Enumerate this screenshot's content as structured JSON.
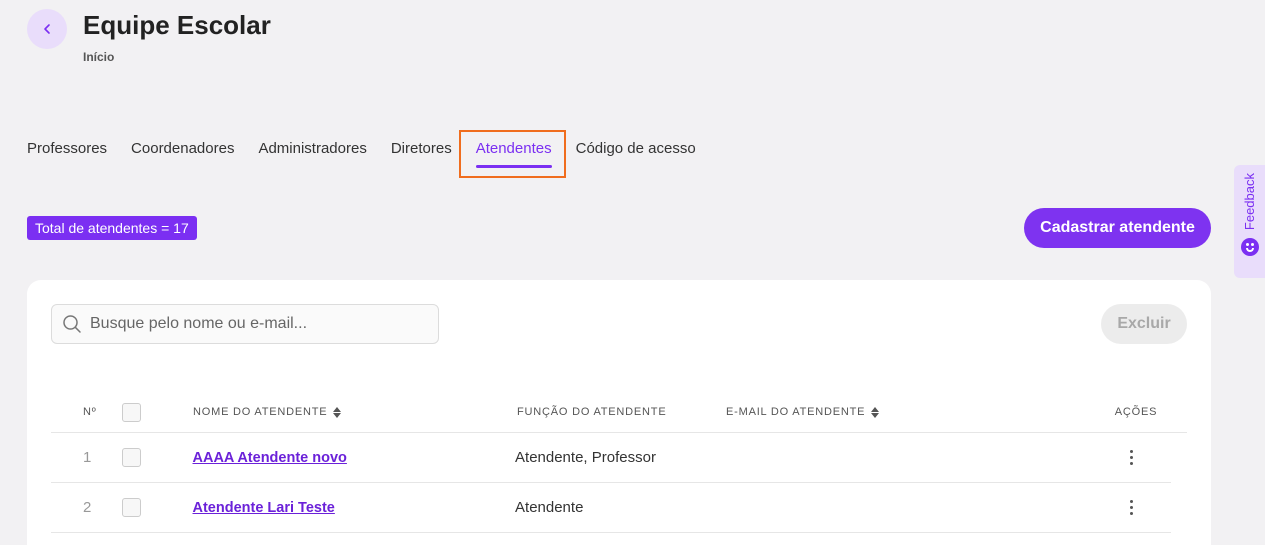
{
  "header": {
    "title": "Equipe Escolar",
    "breadcrumb": "Início"
  },
  "tabs": [
    {
      "label": "Professores",
      "active": false
    },
    {
      "label": "Coordenadores",
      "active": false
    },
    {
      "label": "Administradores",
      "active": false
    },
    {
      "label": "Diretores",
      "active": false
    },
    {
      "label": "Atendentes",
      "active": true
    },
    {
      "label": "Código de acesso",
      "active": false
    }
  ],
  "summary": {
    "total_label": "Total de atendentes = 17",
    "register_button": "Cadastrar atendente"
  },
  "feedback": {
    "label": "Feedback"
  },
  "toolbar": {
    "search_placeholder": "Busque pelo nome ou e-mail...",
    "delete_button": "Excluir"
  },
  "table": {
    "headers": {
      "num": "Nº",
      "name": "NOME DO ATENDENTE",
      "role": "FUNÇÃO DO ATENDENTE",
      "email": "E-MAIL DO ATENDENTE",
      "actions": "AÇÕES"
    },
    "rows": [
      {
        "num": "1",
        "name": "AAAA Atendente novo",
        "role": "Atendente, Professor"
      },
      {
        "num": "2",
        "name": "Atendente Lari Teste",
        "role": "Atendente"
      }
    ]
  },
  "colors": {
    "accent": "#7b2ff2",
    "highlight_border": "#f06d1e",
    "background": "#f2f1f3"
  }
}
